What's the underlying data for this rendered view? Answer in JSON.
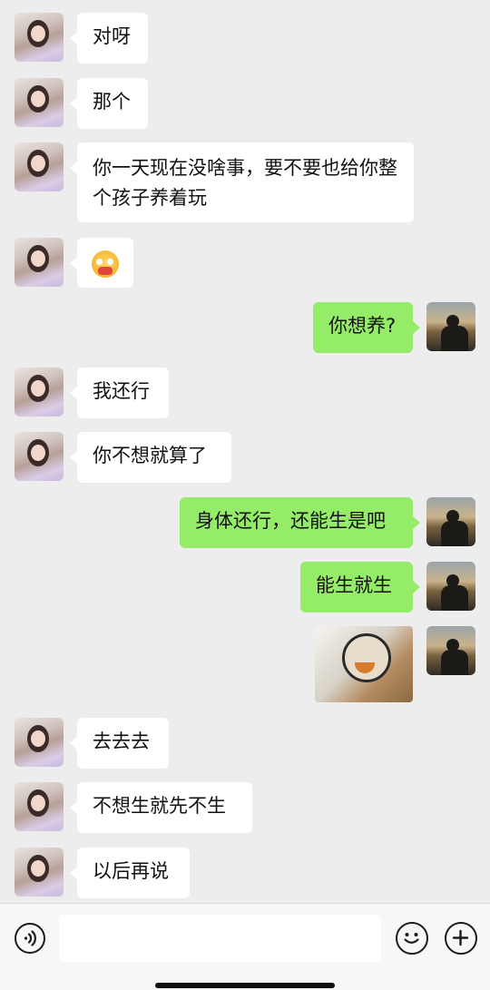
{
  "messages": [
    {
      "side": "in",
      "text": "对呀"
    },
    {
      "side": "in",
      "text": "那个"
    },
    {
      "side": "in",
      "text": "你一天现在没啥事，要不要也给你整个孩子养着玩"
    },
    {
      "side": "in",
      "emoji": "flushed-face-emoji"
    },
    {
      "side": "out",
      "text": "你想养?"
    },
    {
      "side": "in",
      "text": "我还行"
    },
    {
      "side": "in",
      "text": "你不想就算了"
    },
    {
      "side": "out",
      "text": "身体还行，还能生是吧"
    },
    {
      "side": "out",
      "text": "能生就生"
    },
    {
      "side": "out",
      "sticker": "panda-meme-sticker"
    },
    {
      "side": "in",
      "text": "去去去"
    },
    {
      "side": "in",
      "text": "不想生就先不生"
    },
    {
      "side": "in",
      "text": "以后再说"
    }
  ],
  "input": {
    "value": ""
  },
  "icons": {
    "voice": "voice-icon",
    "emoji": "emoji-icon",
    "add": "plus-icon"
  },
  "colors": {
    "background": "#ededed",
    "incoming_bubble": "#ffffff",
    "outgoing_bubble": "#95ec69",
    "text": "#111111"
  }
}
